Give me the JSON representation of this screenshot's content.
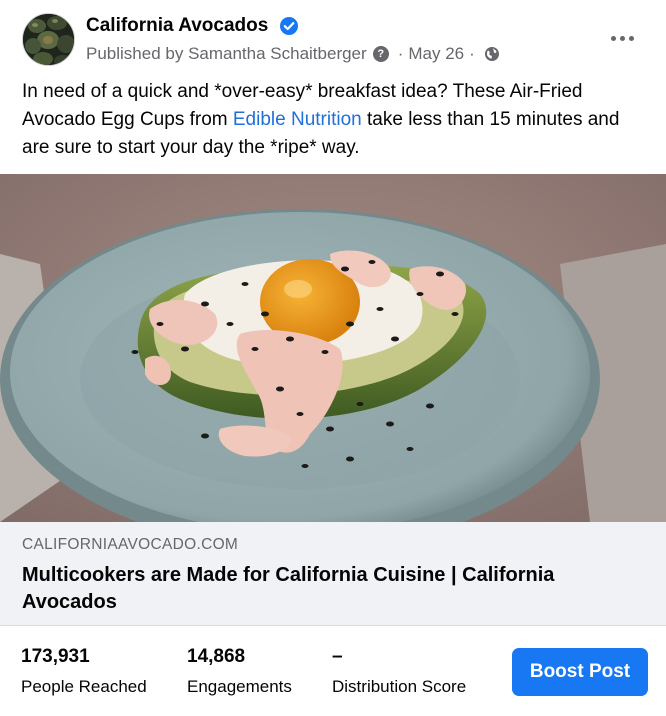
{
  "post": {
    "page_name": "California Avocados",
    "publisher": "Published by Samantha Schaitberger",
    "date": "May 26",
    "separator": "·",
    "help_glyph": "?",
    "text_part1": "In need of a quick and *over-easy* breakfast idea? These Air-Fried Avocado Egg Cups from ",
    "text_link": "Edible Nutrition",
    "text_part2": " take less than 15 minutes and are sure to start your day the *ripe* way."
  },
  "link_preview": {
    "domain": "CALIFORNIAAVOCADO.COM",
    "title": "Multicookers are Made for California Cuisine | California Avocados"
  },
  "stats": {
    "reached_value": "173,931",
    "reached_label": "People Reached",
    "engagements_value": "14,868",
    "engagements_label": "Engagements",
    "distribution_value": "–",
    "distribution_label": "Distribution Score"
  },
  "actions": {
    "boost_label": "Boost Post"
  },
  "icons": {
    "verified": "verified-badge-icon",
    "help": "question-icon",
    "privacy": "globe-icon",
    "more": "more-options-icon"
  },
  "colors": {
    "link": "#216fdb",
    "verified": "#1877f2",
    "boost_button": "#1877f2",
    "secondary_text": "#65676b",
    "preview_bg": "#f0f2f5"
  }
}
